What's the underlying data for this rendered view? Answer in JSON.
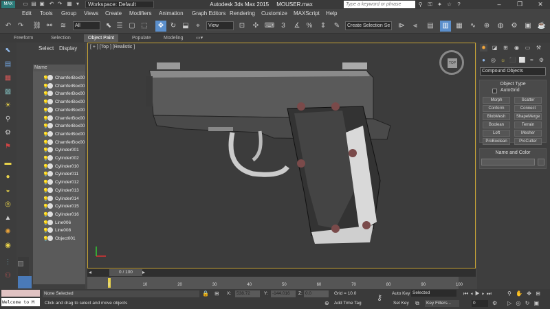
{
  "title_bar": {
    "app_title": "Autodesk 3ds Max  2015",
    "file_name": "MOUSER.max",
    "workspace_label": "Workspace: Default",
    "help_search_placeholder": "Type a keyword or phrase",
    "logo_text": "MAX"
  },
  "menu": [
    "Edit",
    "Tools",
    "Group",
    "Views",
    "Create",
    "Modifiers",
    "Animation",
    "Graph Editors",
    "Rendering",
    "Customize",
    "MAXScript",
    "Help"
  ],
  "toolbar": {
    "selection_filter": "All",
    "reference_coord": "View",
    "named_selection_set": "Create Selection Se"
  },
  "ribbon_tabs": [
    "Freeform",
    "Selection",
    "Object Paint",
    "Populate",
    "Modeling"
  ],
  "ribbon_active": "Object Paint",
  "scene_explorer": {
    "tabs": [
      "Select",
      "Display"
    ],
    "column_header": "Name",
    "objects": [
      "ChamferBox00",
      "ChamferBox00",
      "ChamferBox00",
      "ChamferBox00",
      "ChamferBox00",
      "ChamferBox00",
      "ChamferBox00",
      "ChamferBox00",
      "ChamferBox00",
      "Cylinder001",
      "Cylinder002",
      "Cylinder010",
      "Cylinder011",
      "Cylinder012",
      "Cylinder013",
      "Cylinder014",
      "Cylinder015",
      "Cylinder016",
      "Line006",
      "Line008",
      "Object001"
    ]
  },
  "viewport": {
    "label": "[ + ] [Top ] [Realistic ]",
    "viewcube_face": "TOP"
  },
  "command_panel": {
    "category": "Compound Objects",
    "object_type_title": "Object Type",
    "autogrid_label": "AutoGrid",
    "buttons": [
      "Morph",
      "Scatter",
      "Conform",
      "Connect",
      "BlobMesh",
      "ShapeMerge",
      "Boolean",
      "Terrain",
      "Loft",
      "Mesher",
      "ProBoolean",
      "ProCutter"
    ],
    "name_color_title": "Name and Color"
  },
  "timeline": {
    "slider_label": "0 / 100",
    "ticks": [
      "0",
      "10",
      "20",
      "30",
      "40",
      "50",
      "60",
      "70",
      "80",
      "90",
      "100"
    ],
    "slider_position_fraction": 0.0
  },
  "status": {
    "welcome": "Welcome to M",
    "selection": "None Selected",
    "prompt": "Click and drag to select and move objects",
    "x_label": "X:",
    "x_value": "538.72",
    "y_label": "Y:",
    "y_value": "-144.016",
    "z_label": "Z:",
    "z_value": "0.0",
    "grid": "Grid = 10.0",
    "add_time_tag": "Add Time Tag",
    "auto_key": "Auto Key",
    "auto_key_mode": "Selected",
    "set_key": "Set Key",
    "key_filters": "Key Filters...",
    "frame_value": "0"
  },
  "colors": {
    "viewport_border": "#c8a435",
    "accent_active": "#5b8fcc",
    "bulb": "#e8d24a"
  }
}
